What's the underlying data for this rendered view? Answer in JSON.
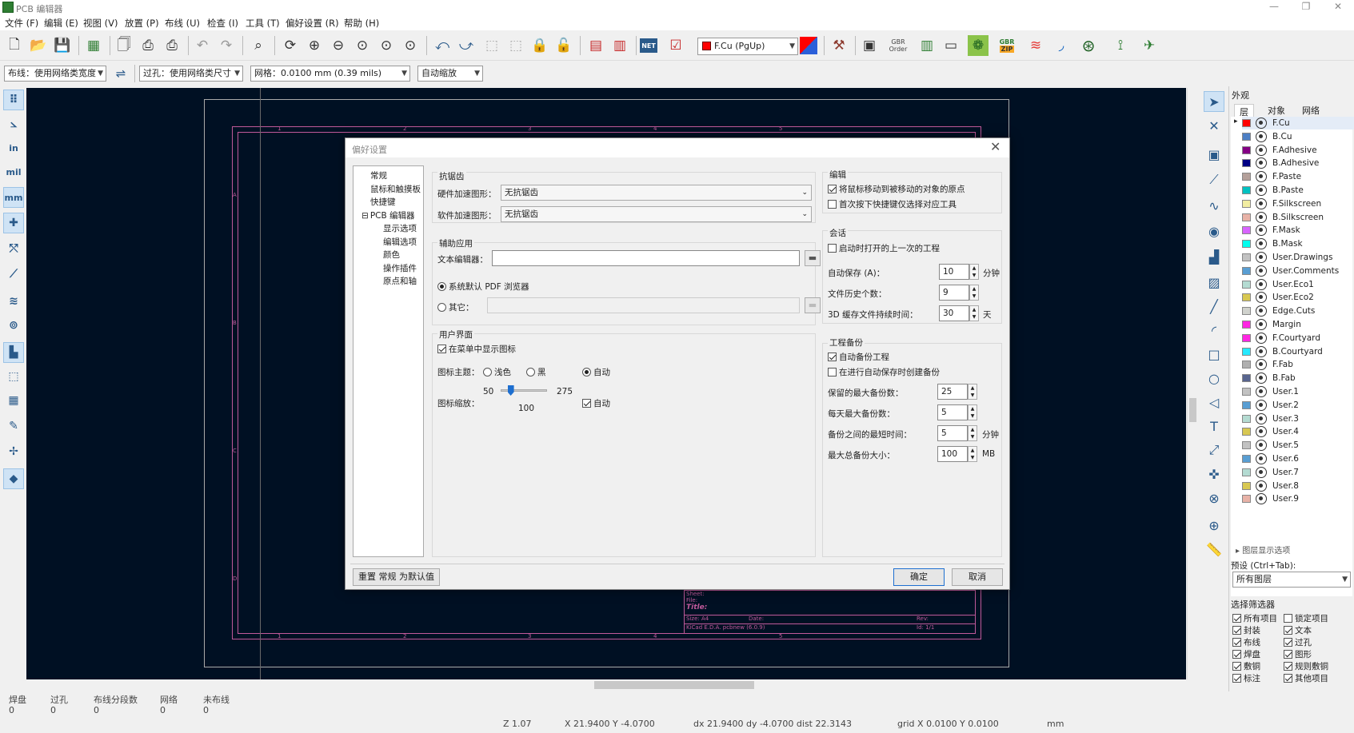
{
  "app": {
    "title": "PCB 编辑器"
  },
  "window_controls": {
    "minimize": "—",
    "restore": "❐",
    "close": "✕"
  },
  "menu": [
    "文件 (F)",
    "编辑 (E)",
    "视图 (V)",
    "放置 (P)",
    "布线 (U)",
    "检查 (I)",
    "工具 (T)",
    "偏好设置 (R)",
    "帮助 (H)"
  ],
  "toolbar": {
    "layer_select": "F.Cu (PgUp)",
    "gbr_order_line1": "GBR",
    "gbr_order_line2": "Order",
    "gbr_zip": "GBR",
    "zip_label": "ZIP",
    "net_label": "NET",
    "icons": [
      "new-board",
      "open",
      "save",
      "board-setup",
      "page-settings",
      "print",
      "plot",
      "undo",
      "redo",
      "find",
      "refresh",
      "zoom-in",
      "zoom-out",
      "zoom-fit",
      "zoom-objects",
      "zoom-selection",
      "rotate-ccw",
      "rotate-cw",
      "group",
      "ungroup",
      "lock",
      "unlock",
      "footprint-editor",
      "footprint-browser",
      "netlist",
      "drc",
      "layer-pair",
      "scripting",
      "3d-viewer"
    ]
  },
  "toolbar2": {
    "track_width": "布线：使用网络类宽度",
    "via_size": "过孔：使用网络类尺寸",
    "grid": "网格：0.0100 mm (0.39 mils)",
    "zoom": "自动缩放"
  },
  "left_toolbar": [
    {
      "name": "grid-toggle-icon",
      "glyph": "⠿",
      "on": true
    },
    {
      "name": "polar-coords-icon",
      "glyph": "⦣"
    },
    {
      "name": "units-inch-icon",
      "glyph": "in"
    },
    {
      "name": "units-mil-icon",
      "glyph": "mil"
    },
    {
      "name": "units-mm-icon",
      "glyph": "mm",
      "on": true
    },
    {
      "name": "cursor-shape-icon",
      "glyph": "✚",
      "on": true
    },
    {
      "name": "ratsnest-icon",
      "glyph": "⤲"
    },
    {
      "name": "curved-ratsnest-icon",
      "glyph": "⟋"
    },
    {
      "name": "zone-fill-icon",
      "glyph": "≋"
    },
    {
      "name": "via-display-icon",
      "glyph": "⊚"
    },
    {
      "name": "track-display-icon",
      "glyph": "▙",
      "on": true
    },
    {
      "name": "outline-mode-icon",
      "glyph": "⬚"
    },
    {
      "name": "pad-outline-icon",
      "glyph": "▦"
    },
    {
      "name": "show-net-names-icon",
      "glyph": "✎"
    },
    {
      "name": "high-contrast-icon",
      "glyph": "✢"
    },
    {
      "name": "layer-appearance-icon",
      "glyph": "◆",
      "on": true
    }
  ],
  "right_toolbar": [
    {
      "name": "select-arrow-icon",
      "glyph": "➤",
      "on": true
    },
    {
      "name": "local-ratsnest-icon",
      "glyph": "✕"
    },
    {
      "name": "add-footprint-icon",
      "glyph": "▣"
    },
    {
      "name": "route-track-icon",
      "glyph": "⟋"
    },
    {
      "name": "diff-pair-icon",
      "glyph": "∿"
    },
    {
      "name": "add-via-icon",
      "glyph": "◉"
    },
    {
      "name": "add-zone-icon",
      "glyph": "▟"
    },
    {
      "name": "rule-area-icon",
      "glyph": "▨"
    },
    {
      "name": "draw-line-icon",
      "glyph": "╱"
    },
    {
      "name": "draw-arc-icon",
      "glyph": "◜"
    },
    {
      "name": "draw-rect-icon",
      "glyph": "□"
    },
    {
      "name": "draw-circle-icon",
      "glyph": "○"
    },
    {
      "name": "draw-polygon-icon",
      "glyph": "◁"
    },
    {
      "name": "add-text-icon",
      "glyph": "T"
    },
    {
      "name": "dimension-icon",
      "glyph": "⤢"
    },
    {
      "name": "target-icon",
      "glyph": "✜"
    },
    {
      "name": "delete-icon",
      "glyph": "⊗"
    },
    {
      "name": "place-origin-icon",
      "glyph": "⊕"
    },
    {
      "name": "measure-icon",
      "glyph": "📏"
    }
  ],
  "panel": {
    "title": "外观",
    "tabs": [
      "层",
      "对象",
      "网络"
    ],
    "layers": [
      {
        "name": "F.Cu",
        "color": "#ff0000",
        "active": true
      },
      {
        "name": "B.Cu",
        "color": "#4d7fc4"
      },
      {
        "name": "F.Adhesive",
        "color": "#840084"
      },
      {
        "name": "B.Adhesive",
        "color": "#000084"
      },
      {
        "name": "F.Paste",
        "color": "#b4a09a"
      },
      {
        "name": "B.Paste",
        "color": "#00c2c2"
      },
      {
        "name": "F.Silkscreen",
        "color": "#f2eda1"
      },
      {
        "name": "B.Silkscreen",
        "color": "#e8b2a7"
      },
      {
        "name": "F.Mask",
        "color": "#d864ff"
      },
      {
        "name": "B.Mask",
        "color": "#02ffee"
      },
      {
        "name": "User.Drawings",
        "color": "#c2c2c2"
      },
      {
        "name": "User.Comments",
        "color": "#599ed3"
      },
      {
        "name": "User.Eco1",
        "color": "#b4dbd2"
      },
      {
        "name": "User.Eco2",
        "color": "#d8c852"
      },
      {
        "name": "Edge.Cuts",
        "color": "#d0d2cd"
      },
      {
        "name": "Margin",
        "color": "#ff26e2"
      },
      {
        "name": "F.Courtyard",
        "color": "#ff26e2"
      },
      {
        "name": "B.Courtyard",
        "color": "#26e9ff"
      },
      {
        "name": "F.Fab",
        "color": "#afafaf"
      },
      {
        "name": "B.Fab",
        "color": "#58658f"
      },
      {
        "name": "User.1",
        "color": "#c2c2c2"
      },
      {
        "name": "User.2",
        "color": "#599ed3"
      },
      {
        "name": "User.3",
        "color": "#b4dbd2"
      },
      {
        "name": "User.4",
        "color": "#d8c852"
      },
      {
        "name": "User.5",
        "color": "#c2c2c2"
      },
      {
        "name": "User.6",
        "color": "#599ed3"
      },
      {
        "name": "User.7",
        "color": "#b4dbd2"
      },
      {
        "name": "User.8",
        "color": "#d8c852"
      },
      {
        "name": "User.9",
        "color": "#e8b2a7"
      }
    ],
    "layer_display_options": "图层显示选项",
    "preset_label": "预设 (Ctrl+Tab):",
    "preset_value": "所有图层",
    "filter_title": "选择筛选器",
    "filters": [
      {
        "label": "所有项目",
        "checked": true
      },
      {
        "label": "锁定项目",
        "checked": false
      },
      {
        "label": "封装",
        "checked": true
      },
      {
        "label": "文本",
        "checked": true
      },
      {
        "label": "布线",
        "checked": true
      },
      {
        "label": "过孔",
        "checked": true
      },
      {
        "label": "焊盘",
        "checked": true
      },
      {
        "label": "图形",
        "checked": true
      },
      {
        "label": "敷铜",
        "checked": true
      },
      {
        "label": "规则敷铜",
        "checked": true
      },
      {
        "label": "标注",
        "checked": true
      },
      {
        "label": "其他项目",
        "checked": true
      }
    ]
  },
  "status": {
    "pads_label": "焊盘",
    "pads": "0",
    "vias_label": "过孔",
    "vias": "0",
    "segments_label": "布线分段数",
    "segments": "0",
    "nets_label": "网络",
    "nets": "0",
    "unrouted_label": "未布线",
    "unrouted": "0",
    "zoom": "Z 1.07",
    "cursor": "X 21.9400  Y -4.0700",
    "delta": "dx 21.9400  dy -4.0700  dist 22.3143",
    "grid": "grid X 0.0100  Y 0.0100",
    "units": "mm"
  },
  "sheet": {
    "ruler_top": [
      "1",
      "2",
      "3",
      "4",
      "5"
    ],
    "ruler_left": [
      "A",
      "B",
      "C",
      "D"
    ],
    "sheet_label": "Sheet:",
    "file_label": "File:",
    "title_label": "Title:",
    "size_label": "Size: A4",
    "date_label": "Date:",
    "rev_label": "Rev:",
    "kicad_label": "KiCad E.D.A.  pcbnew (6.0.9)",
    "id_label": "Id: 1/1"
  },
  "dialog": {
    "title": "偏好设置",
    "tree": [
      {
        "label": "常规",
        "indent": 1
      },
      {
        "label": "鼠标和触摸板",
        "indent": 1
      },
      {
        "label": "快捷键",
        "indent": 1
      },
      {
        "label": "PCB 编辑器",
        "indent": 0,
        "expander": "⊟"
      },
      {
        "label": "显示选项",
        "indent": 2
      },
      {
        "label": "编辑选项",
        "indent": 2
      },
      {
        "label": "颜色",
        "indent": 2
      },
      {
        "label": "操作插件",
        "indent": 2
      },
      {
        "label": "原点和轴",
        "indent": 2
      }
    ],
    "antialias": {
      "title": "抗锯齿",
      "hw_label": "硬件加速图形：",
      "hw_value": "无抗锯齿",
      "sw_label": "软件加速图形：",
      "sw_value": "无抗锯齿"
    },
    "helper": {
      "title": "辅助应用",
      "text_editor_label": "文本编辑器：",
      "text_editor_value": "",
      "pdf_default": "系统默认 PDF 浏览器",
      "pdf_other": "其它："
    },
    "ui": {
      "title": "用户界面",
      "show_icons": "在菜单中显示图标",
      "theme_label": "图标主题：",
      "theme_light": "浅色",
      "theme_dark": "黑",
      "theme_auto": "自动",
      "scale_label": "图标缩放：",
      "scale_min": "50",
      "scale_max": "275",
      "scale_value": "100",
      "scale_auto": "自动",
      "scale_fraction": 0.2
    },
    "editing": {
      "title": "编辑",
      "warp_mouse": "将鼠标移动到被移动的对象的原点",
      "first_hotkey": "首次按下快捷键仅选择对应工具"
    },
    "session": {
      "title": "会话",
      "reopen": "启动时打开的上一次的工程",
      "autosave_label": "自动保存 (A)：",
      "autosave_value": "10",
      "autosave_unit": "分钟",
      "history_label": "文件历史个数：",
      "history_value": "9",
      "cache_label": "3D 缓存文件持续时间：",
      "cache_value": "30",
      "cache_unit": "天"
    },
    "backup": {
      "title": "工程备份",
      "auto_backup": "自动备份工程",
      "on_autosave": "在进行自动保存时创建备份",
      "max_label": "保留的最大备份数：",
      "max_value": "25",
      "daily_label": "每天最大备份数：",
      "daily_value": "5",
      "interval_label": "备份之间的最短时间：",
      "interval_value": "5",
      "interval_unit": "分钟",
      "size_label": "最大总备份大小：",
      "size_value": "100",
      "size_unit": "MB"
    },
    "reset_button": "重置 常规 为默认值",
    "ok_button": "确定",
    "cancel_button": "取消"
  }
}
